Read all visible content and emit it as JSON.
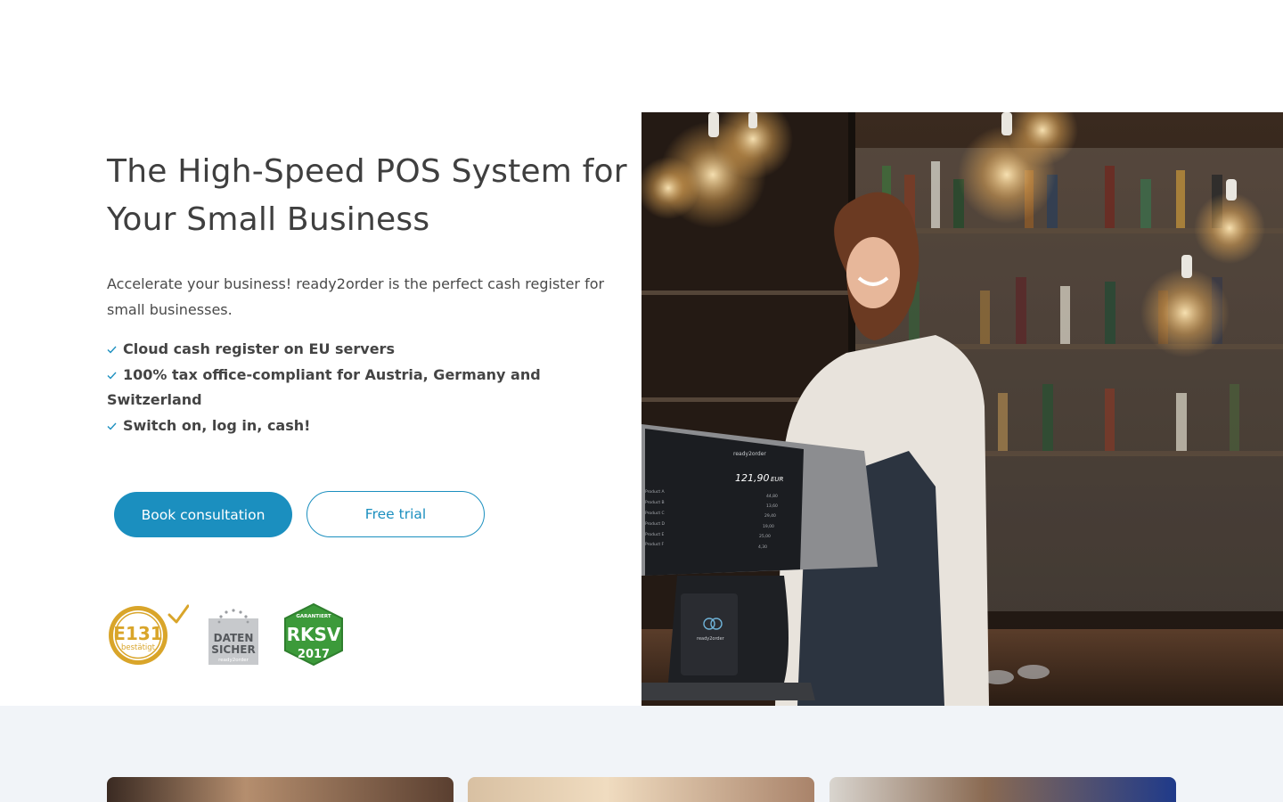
{
  "hero": {
    "title": "The High-Speed POS System for Your Small Business",
    "lead": "Accelerate your business! ready2order is the perfect cash register for small businesses.",
    "features": [
      "Cloud cash register on EU servers",
      "100% tax office-compliant for Austria, Germany and Switzerland",
      "Switch on, log in, cash!"
    ],
    "primary_button": "Book consultation",
    "secondary_button": "Free trial"
  },
  "seals": {
    "e131": {
      "main": "E131",
      "sub": "bestätigt"
    },
    "datensicher": {
      "line1": "DATEN",
      "line2": "SICHER",
      "sub": "ready2order"
    },
    "rksv": {
      "top": "GARANTIERT",
      "main": "RKSV",
      "year": "2017"
    }
  },
  "pos_screen": {
    "brand": "ready2order",
    "total": "121,90",
    "currency": "EUR",
    "items": [
      {
        "name": "Product A",
        "price": "44,80"
      },
      {
        "name": "Product B",
        "price": "13,60"
      },
      {
        "name": "Product C",
        "price": "29,40"
      },
      {
        "name": "Product D",
        "price": "19,00"
      },
      {
        "name": "Product E",
        "price": "25,00"
      },
      {
        "name": "Product F",
        "price": "4,30"
      }
    ],
    "device_label": "ready2order"
  },
  "colors": {
    "accent": "#1b8fbf",
    "band": "#f1f4f8",
    "text": "#444444",
    "seal_gold": "#d9a52a",
    "seal_green": "#3c9a3a"
  }
}
